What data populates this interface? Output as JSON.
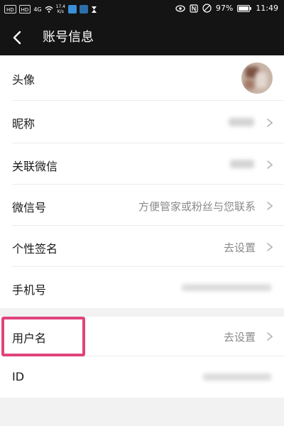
{
  "status_bar": {
    "hd1": "HD",
    "hd2": "HD",
    "net": "4G",
    "speed_value": "17.4",
    "speed_unit": "K/s",
    "battery": "97%",
    "time": "11:49"
  },
  "header": {
    "title": "账号信息"
  },
  "rows": [
    {
      "label": "头像",
      "value": ""
    },
    {
      "label": "昵称",
      "value": ""
    },
    {
      "label": "关联微信",
      "value": ""
    },
    {
      "label": "微信号",
      "value": "方便管家或粉丝与您联系"
    },
    {
      "label": "个性签名",
      "value": "去设置"
    },
    {
      "label": "手机号",
      "value": ""
    },
    {
      "label": "用户名",
      "value": "去设置"
    },
    {
      "label": "ID",
      "value": ""
    }
  ],
  "colors": {
    "header_bg": "#141414",
    "highlight": "#e0447c",
    "page_bg": "#f2f2f2"
  }
}
